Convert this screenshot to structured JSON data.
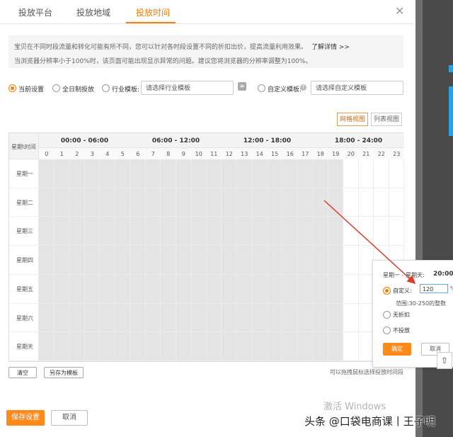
{
  "tabs": [
    "投放平台",
    "投放地域",
    "投放时间"
  ],
  "notice": {
    "line1": "宝贝在不同时段流量和转化可能有所不同，您可以针对各时段设置不同的折扣出价，提高流量利用效果。",
    "link": "了解详情 >>",
    "line2": "当浏览器分辨率小于100%时，该页面可能出现显示异常的问题。建议您将浏览器的分辨率调整为100%。"
  },
  "options": {
    "current": "当前设置",
    "all_day": "全日制投放",
    "industry": "行业模板:",
    "industry_placeholder": "请选择行业模板",
    "custom": "自定义模板:",
    "custom_placeholder": "请选择自定义模板"
  },
  "view": {
    "grid": "网格视图",
    "list": "列表视图"
  },
  "grid": {
    "corner": "星期\\时间",
    "segments": [
      "00:00 - 06:00",
      "06:00 - 12:00",
      "12:00 - 18:00",
      "18:00 - 24:00"
    ],
    "hours": [
      "0",
      "1",
      "2",
      "3",
      "4",
      "5",
      "6",
      "7",
      "8",
      "9",
      "10",
      "11",
      "12",
      "13",
      "14",
      "15",
      "16",
      "17",
      "18",
      "19",
      "20",
      "21",
      "22",
      "23"
    ],
    "days": [
      "星期一",
      "星期二",
      "星期三",
      "星期四",
      "星期五",
      "星期六",
      "星期天"
    ],
    "active_until_hour": 20
  },
  "actions": {
    "clear": "清空",
    "save_template": "另存为模板",
    "hint": "可以拖拽鼠标选择投放时间段"
  },
  "footer": {
    "save": "保存设置",
    "cancel": "取消"
  },
  "popup": {
    "range": "星期一 - 星期天:",
    "time": "20:00",
    "custom_label": "自定义:",
    "custom_value": "120",
    "suffix": "%",
    "hint": "范围:30-250的整数",
    "no_discount": "无折扣",
    "no_delivery": "不投放",
    "ok": "确定",
    "cancel": "取消"
  },
  "watermark": "激活 Windows",
  "credit": "头条 @口袋电商课丨王子明",
  "colors": {
    "accent": "#ff7a00",
    "arrow": "#e03a2a",
    "active_cell": "#e4e4e4"
  }
}
